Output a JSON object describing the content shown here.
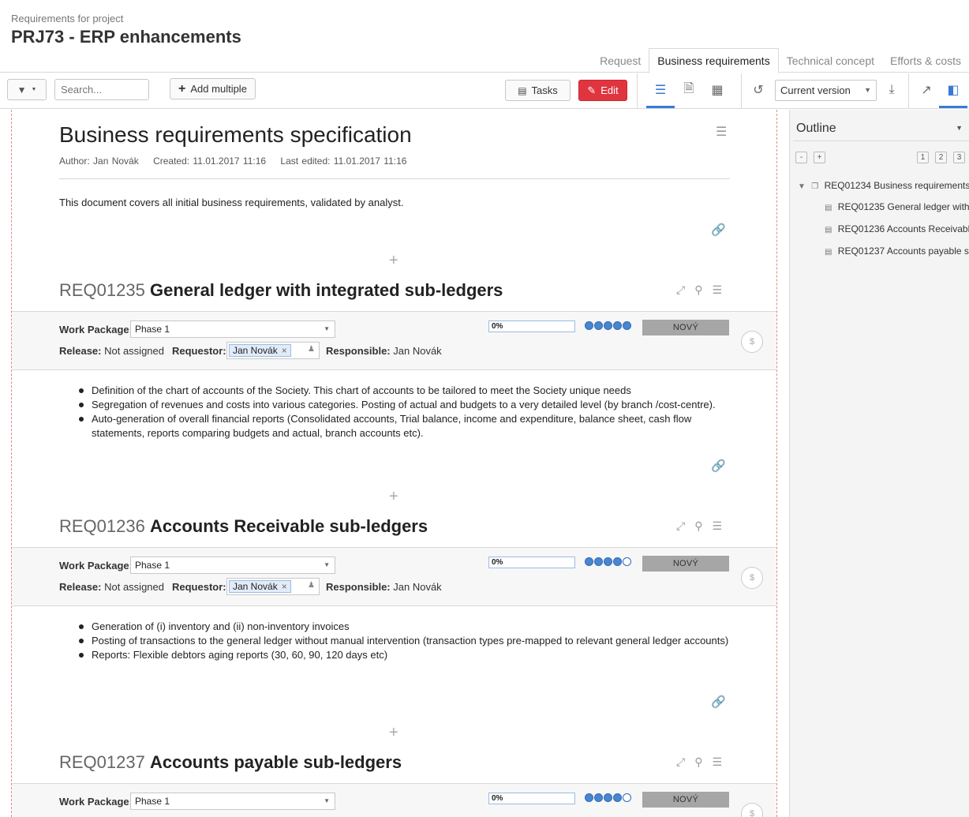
{
  "header": {
    "subtitle": "Requirements for project",
    "title": "PRJ73 - ERP enhancements",
    "tabs": [
      {
        "label": "Request",
        "active": false
      },
      {
        "label": "Business requirements",
        "active": true
      },
      {
        "label": "Technical concept",
        "active": false
      },
      {
        "label": "Efforts & costs",
        "active": false
      }
    ]
  },
  "toolbar": {
    "search_placeholder": "Search...",
    "add_multiple_label": "Add multiple",
    "tasks_label": "Tasks",
    "edit_label": "Edit",
    "version_select": "Current version"
  },
  "document": {
    "title": "Business requirements specification",
    "author": "Author: Jan Novák",
    "created": "Created: 11.01.2017 11:16",
    "last_edited": "Last edited: 11.01.2017 11:16",
    "intro": "This document covers all initial business requirements, validated by analyst."
  },
  "labels": {
    "work_package": "Work Package:",
    "release": "Release:",
    "requestor": "Requestor:",
    "responsible": "Responsible:"
  },
  "requirements": [
    {
      "id": "REQ01235",
      "name": "General ledger with integrated sub-ledgers",
      "work_package": "Phase 1",
      "release": "Not assigned",
      "requestor": "Jan Novák",
      "responsible": "Jan Novák",
      "progress": "0%",
      "progress_value": 0,
      "priority_filled": 5,
      "priority_total": 5,
      "status": "NOVÝ",
      "bullets": [
        "Definition of the chart of accounts of the Society. This chart of accounts to be tailored to meet the Society unique needs",
        "Segregation of revenues and costs into various categories. Posting of actual and budgets to a very detailed level (by branch /cost-centre).",
        "Auto-generation of overall financial reports (Consolidated accounts, Trial balance, income and expenditure, balance sheet, cash flow statements, reports comparing budgets and actual, branch accounts etc)."
      ]
    },
    {
      "id": "REQ01236",
      "name": "Accounts Receivable sub-ledgers",
      "work_package": "Phase 1",
      "release": "Not assigned",
      "requestor": "Jan Novák",
      "responsible": "Jan Novák",
      "progress": "0%",
      "progress_value": 0,
      "priority_filled": 4,
      "priority_total": 5,
      "status": "NOVÝ",
      "bullets": [
        "Generation of (i) inventory and (ii) non-inventory invoices",
        "Posting of transactions to the general ledger without manual intervention (transaction types pre-mapped to relevant general ledger accounts)",
        "Reports: Flexible debtors aging reports (30, 60, 90, 120 days etc)"
      ]
    },
    {
      "id": "REQ01237",
      "name": "Accounts payable sub-ledgers",
      "work_package": "Phase 1",
      "progress": "0%",
      "progress_value": 0,
      "priority_filled": 4,
      "priority_total": 5,
      "status": "NOVÝ"
    }
  ],
  "outline": {
    "title": "Outline",
    "collapse_label": "-",
    "expand_label": "+",
    "levels": [
      "1",
      "2",
      "3"
    ],
    "root": {
      "id": "REQ01234",
      "name": "Business requirements"
    },
    "children": [
      {
        "id": "REQ01235",
        "name": "General ledger with i"
      },
      {
        "id": "REQ01236",
        "name": "Accounts Receivable"
      },
      {
        "id": "REQ01237",
        "name": "Accounts payable su"
      }
    ]
  }
}
